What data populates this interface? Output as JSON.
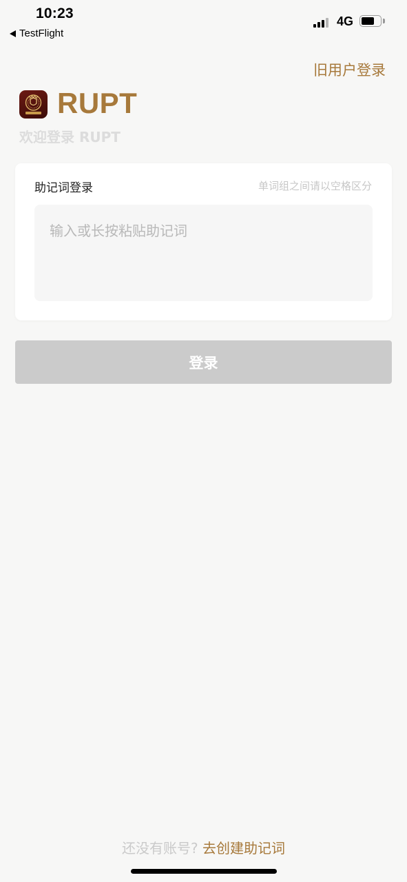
{
  "status_bar": {
    "time": "10:23",
    "back_app": "TestFlight",
    "network": "4G",
    "battery_level": 0.7
  },
  "header": {
    "old_user_login": "旧用户登录",
    "app_name": "RUPT",
    "welcome": "欢迎登录 RUPT",
    "logo_icon": "crest-logo-icon"
  },
  "card": {
    "title": "助记词登录",
    "hint": "单词组之间请以空格区分",
    "input_placeholder": "输入或长按粘贴助记词",
    "input_value": ""
  },
  "login_button": {
    "label": "登录"
  },
  "footer": {
    "no_account": "还没有账号?",
    "create_link": "去创建助记词"
  },
  "colors": {
    "accent": "#a7793b",
    "button_disabled": "#cbcbcb",
    "background": "#f7f7f6"
  }
}
